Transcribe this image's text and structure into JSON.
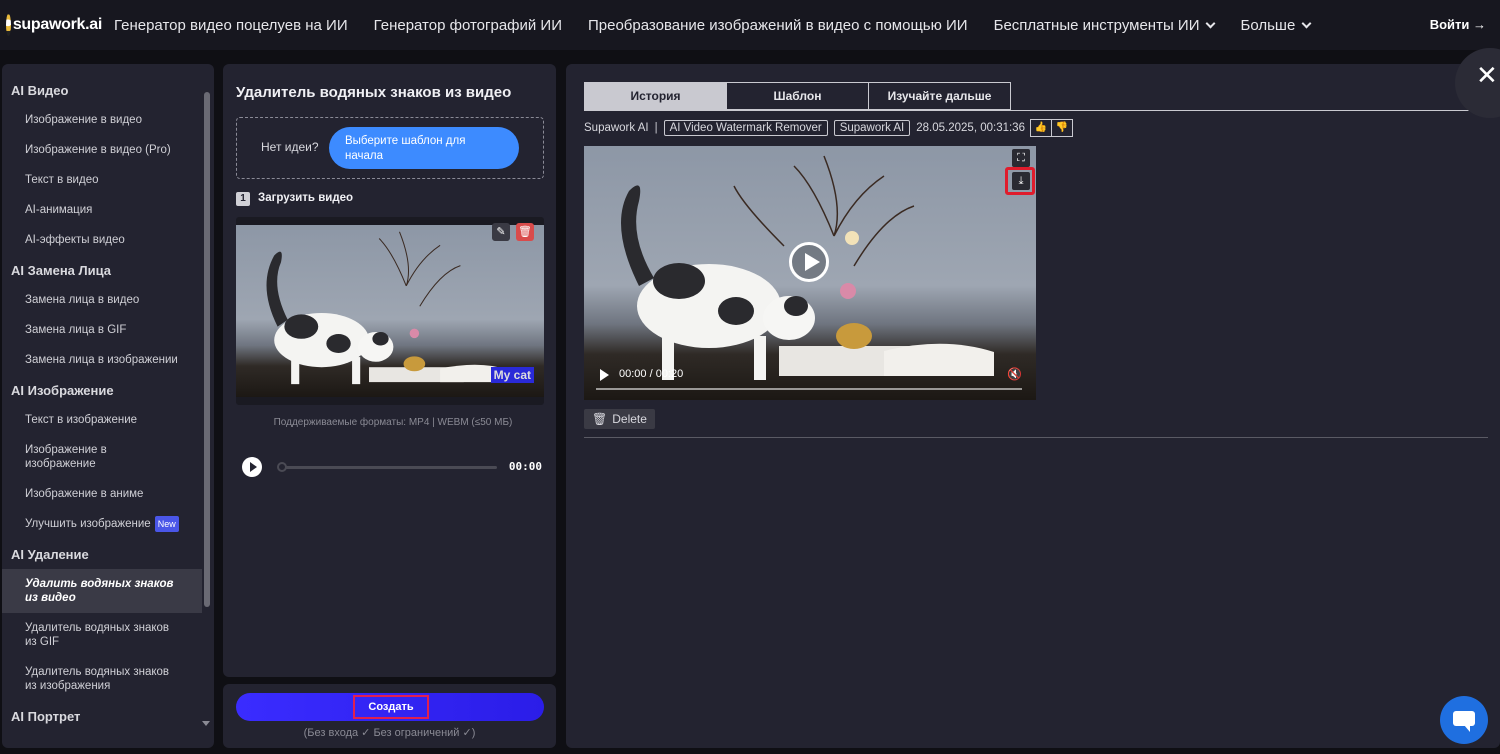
{
  "nav": {
    "logo": "supawork.ai",
    "links": [
      {
        "label": "Генератор видео поцелуев на ИИ",
        "dropdown": false
      },
      {
        "label": "Генератор фотографий ИИ",
        "dropdown": false
      },
      {
        "label": "Преобразование изображений в видео с помощью ИИ",
        "dropdown": false
      },
      {
        "label": "Бесплатные инструменты ИИ",
        "dropdown": true
      },
      {
        "label": "Больше",
        "dropdown": true
      }
    ],
    "login": "Войти →"
  },
  "sidebar": {
    "sections": [
      {
        "title": "AI Видео",
        "items": [
          {
            "label": "Изображение в видео"
          },
          {
            "label": "Изображение в видео (Pro)"
          },
          {
            "label": "Текст в видео"
          },
          {
            "label": "AI-анимация"
          },
          {
            "label": "AI-эффекты видео"
          }
        ]
      },
      {
        "title": "AI Замена Лица",
        "items": [
          {
            "label": "Замена лица в видео"
          },
          {
            "label": "Замена лица в GIF"
          },
          {
            "label": "Замена лица в изображении"
          }
        ]
      },
      {
        "title": "AI Изображение",
        "items": [
          {
            "label": "Текст в изображение"
          },
          {
            "label": "Изображение в изображение"
          },
          {
            "label": "Изображение в аниме"
          },
          {
            "label": "Улучшить изображение",
            "badge": "New"
          }
        ]
      },
      {
        "title": "AI Удаление",
        "items": [
          {
            "label": "Удалить водяных знаков из видео",
            "active": true
          },
          {
            "label": "Удалитель водяных знаков из GIF"
          },
          {
            "label": "Удалитель водяных знаков из изображения"
          }
        ]
      },
      {
        "title": "AI Портрет",
        "items": []
      }
    ]
  },
  "tool": {
    "title": "Удалитель водяных знаков из видео",
    "idea_question": "Нет идеи?",
    "idea_button": "Выберите шаблон для начала",
    "step_number": "1",
    "step_label": "Загрузить видео",
    "thumb_watermark": "My cat",
    "formats": "Поддерживаемые форматы: MP4 | WEBM (≤50 МБ)",
    "audio_time": "00:00",
    "create_button": "Создать",
    "create_note": "(Без входа ✓ Без ограничений ✓)"
  },
  "result": {
    "tabs": [
      {
        "label": "История",
        "active": true
      },
      {
        "label": "Шаблон",
        "active": false
      },
      {
        "label": "Изучайте дальше",
        "active": false
      }
    ],
    "meta": {
      "source": "Supawork AI",
      "chip1": "AI Video Watermark Remover",
      "chip2": "Supawork AI",
      "timestamp": "28.05.2025, 00:31:36"
    },
    "video_time": "00:00 / 00:20",
    "delete_label": "Delete"
  },
  "colors": {
    "accent_blue": "#3d8bff",
    "create_button": "#3a2cff",
    "highlight_red": "#e01c2c"
  }
}
